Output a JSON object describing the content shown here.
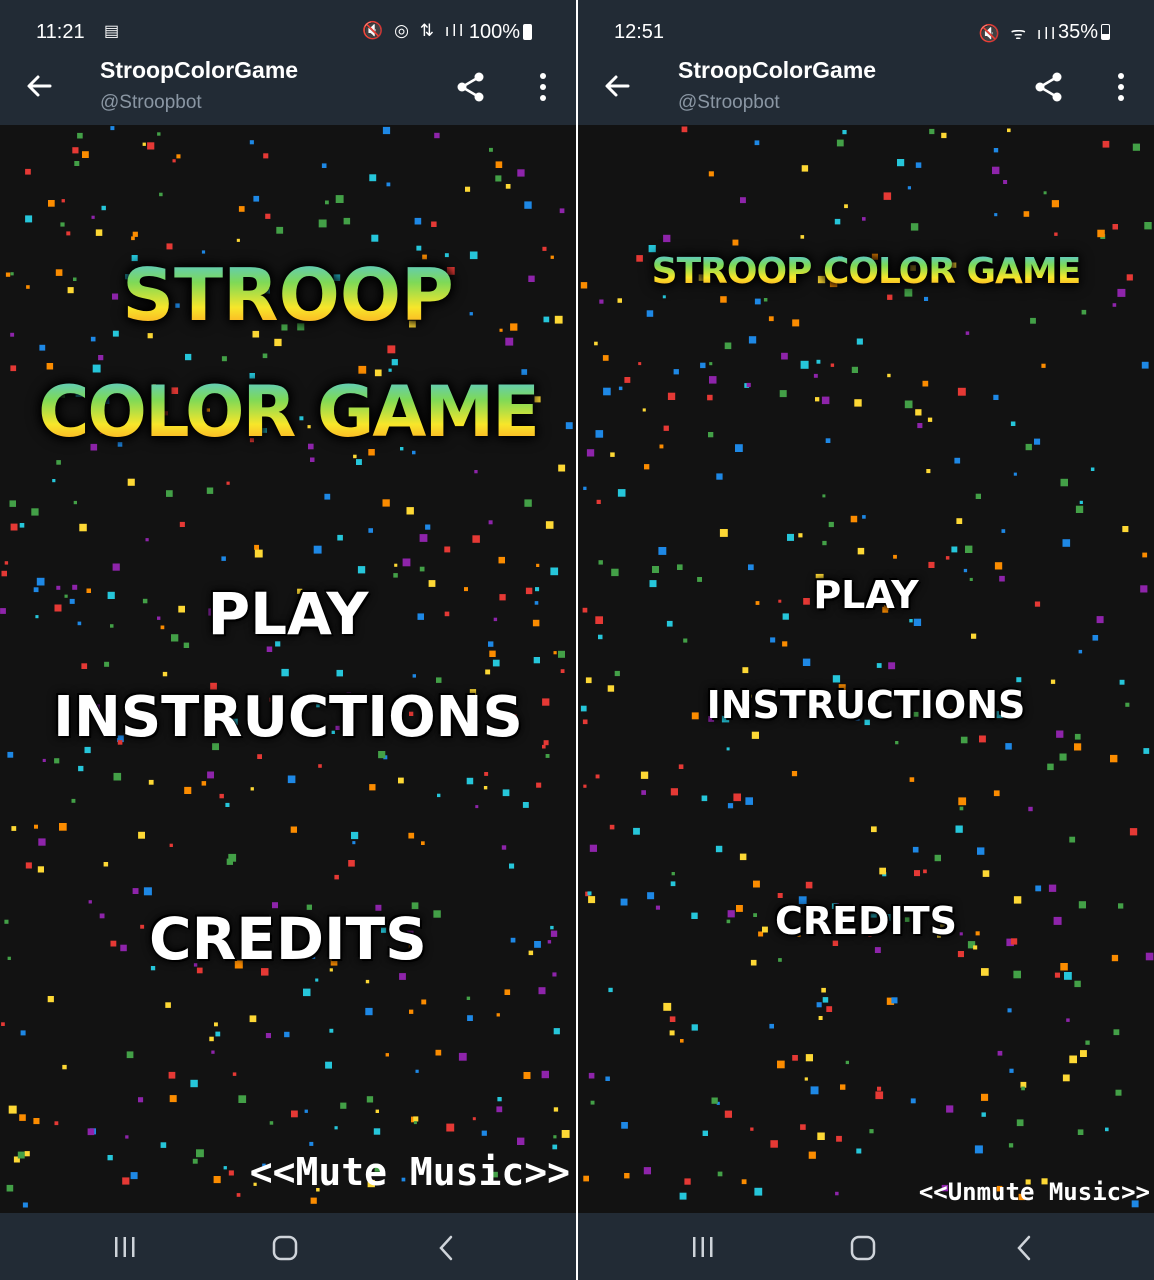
{
  "screens": [
    {
      "status": {
        "time": "11:21",
        "battery": "100%",
        "battery_level": 1.0
      },
      "chat": {
        "title": "StroopColorGame",
        "subtitle": "@Stroopbot"
      },
      "game": {
        "title_line1": "STROOP",
        "title_line2": "COLOR GAME",
        "play": "PLAY",
        "instructions": "INSTRUCTIONS",
        "credits": "CREDITS",
        "music_toggle": "<<Mute Music>>"
      }
    },
    {
      "status": {
        "time": "12:51",
        "battery": "35%",
        "battery_level": 0.35
      },
      "chat": {
        "title": "StroopColorGame",
        "subtitle": "@Stroopbot"
      },
      "game": {
        "title": "STROOP COLOR GAME",
        "play": "PLAY",
        "instructions": "INSTRUCTIONS",
        "credits": "CREDITS",
        "music_toggle": "<<Unmute Music>>"
      }
    }
  ],
  "icons": {
    "back": "arrow-left-icon",
    "share": "share-icon",
    "more": "more-vertical-icon",
    "nav_recents": "recents-icon",
    "nav_home": "home-icon",
    "nav_back": "nav-back-icon"
  },
  "colors": {
    "bar_background": "#222b35",
    "game_background": "#121212",
    "subtitle_text": "#8a96a3",
    "confetti": [
      "#e53935",
      "#43a047",
      "#1e88e5",
      "#fdd835",
      "#8e24aa",
      "#fb8c00",
      "#26c6da"
    ]
  }
}
